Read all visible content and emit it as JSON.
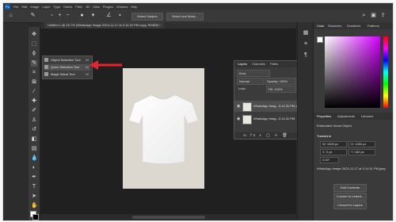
{
  "menubar": {
    "logo": "Ps",
    "items": [
      "File",
      "Edit",
      "Image",
      "Layer",
      "Type",
      "Select",
      "Filter",
      "3D",
      "View",
      "Plugins",
      "Window",
      "Help"
    ]
  },
  "options_bar": {
    "select_subject": "Select Subject",
    "select_and_mask": "Select and Mask..."
  },
  "document": {
    "tab_title": "Untitled-1 @ 16.7% (WhatsApp Image 2024-11-17 at 3.14.31 PM copy, RGB/8) *"
  },
  "tool_flyout": {
    "items": [
      {
        "label": "Object Selection Tool",
        "key": "W"
      },
      {
        "label": "Quick Selection Tool",
        "key": "W"
      },
      {
        "label": "Magic Wand Tool",
        "key": "W"
      }
    ]
  },
  "layers_panel": {
    "tabs": [
      "Layers",
      "Channels",
      "Paths"
    ],
    "filter_kind": "Kind",
    "blend_mode": "Normal",
    "opacity_label": "Opacity: 100%",
    "lock_label": "Lock:",
    "fill_label": "Fill: 100%",
    "layers": [
      {
        "name": "WhatsApp Imag...3.14.31 PM copy",
        "selected": true
      },
      {
        "name": "WhatsApp Imag...3.14.31 PM",
        "selected": false
      }
    ]
  },
  "right_panels": {
    "top_tabs": [
      "Color",
      "Swatches",
      "Gradients",
      "Patterns"
    ],
    "prop_tabs": [
      "Properties",
      "Adjustments",
      "Libraries"
    ],
    "pixel_layer": "Embedded Smart Object",
    "transform_label": "Transform",
    "w_value": "W: 1000 px",
    "h_value": "H: 1280 px",
    "x_value": "X: 0 px",
    "y_value": "Y: 180 px",
    "angle_value": "0.00°",
    "file_name": "WhatsApp Image 2024-11-17 at 3.14.31 PM.jpeg",
    "buttons": [
      "Edit Contents",
      "Convert to Linked...",
      "Convert to Layers"
    ]
  },
  "colors": {
    "arrow": "#e0262e",
    "accent": "#2d7bd8"
  }
}
